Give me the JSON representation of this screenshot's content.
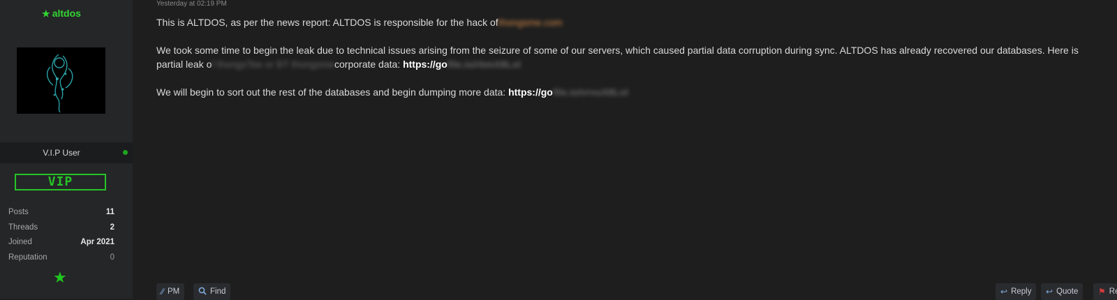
{
  "user": {
    "name": "altdos",
    "title": "V.I.P User",
    "badge": "VIP",
    "stats": [
      {
        "label": "Posts",
        "value": "11"
      },
      {
        "label": "Threads",
        "value": "2"
      },
      {
        "label": "Joined",
        "value": "Apr 2021"
      },
      {
        "label": "Reputation",
        "value": "0"
      }
    ]
  },
  "post": {
    "date": "Yesterday at 02:19 PM",
    "p1_text": "This is ALTDOS, as per the news report: ALTDOS is responsible for the hack of",
    "p1_blur": "thongsme.com",
    "p2_line1": "We took some time to begin the leak due to technical issues arising from the seizure of some of our servers, which caused partial data corruption during sync. ALTDOS has already recovered our databases. Here is",
    "p2_line2_a": "partial leak o",
    "p2_line2_blur": "f thongsTee or BT thongsme",
    "p2_line2_b": "corporate data:",
    "p2_link": "https://go",
    "p2_link_blur": "file.io/rbmX8Lol",
    "p3_text": "We will begin to sort out the rest of the databases and begin dumping more data:",
    "p3_link": "https://go",
    "p3_link_blur": "file.io/vrvuX8Lol"
  },
  "actions": {
    "pm": "PM",
    "find": "Find",
    "reply": "Reply",
    "quote": "Quote",
    "report": "Re"
  }
}
